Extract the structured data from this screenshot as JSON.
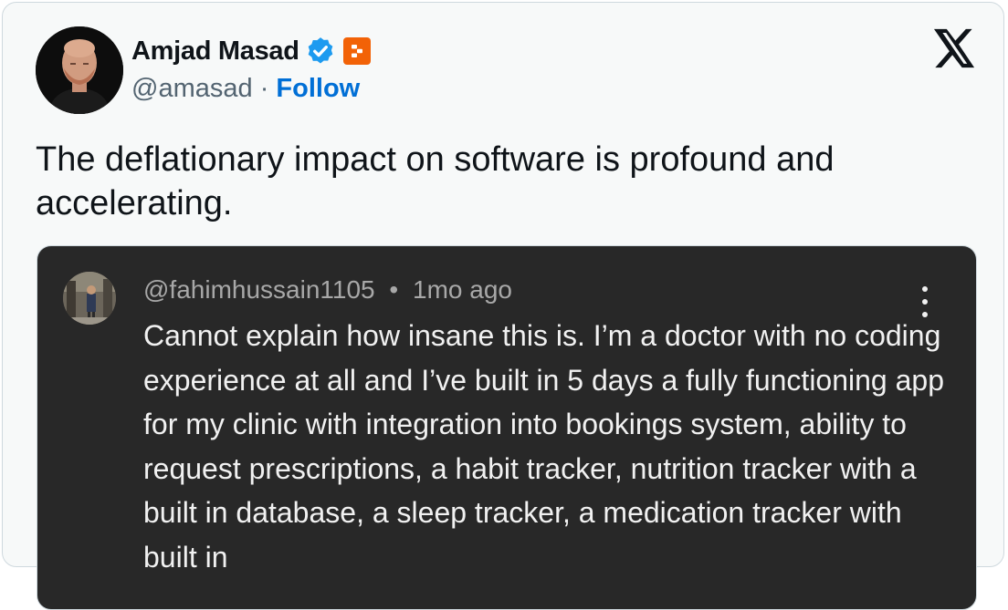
{
  "tweet": {
    "author_name": "Amjad Masad",
    "handle": "@amasad",
    "separator": "·",
    "follow_label": "Follow",
    "text": "The deflationary impact on software is profound and accelerating.",
    "icons": {
      "verified": "verified-check-icon",
      "affiliate": "replit-badge-icon",
      "platform": "x-logo-icon"
    },
    "colors": {
      "verified": "#1d9bf0",
      "affiliate": "#f26207",
      "follow": "#006fd6"
    }
  },
  "quoted_comment": {
    "handle": "@fahimhussain1105",
    "separator": "•",
    "time": "1mo ago",
    "text": "Cannot explain how insane this is. I’m a doctor with no coding experience at all and I’ve built in 5 days a fully functioning app for my clinic with integration into bookings system, ability to request prescriptions, a habit tracker, nutrition tracker with a built in database, a sleep tracker, a medication tracker with built in",
    "menu_icon": "more-vertical-icon",
    "background": "#282828"
  }
}
